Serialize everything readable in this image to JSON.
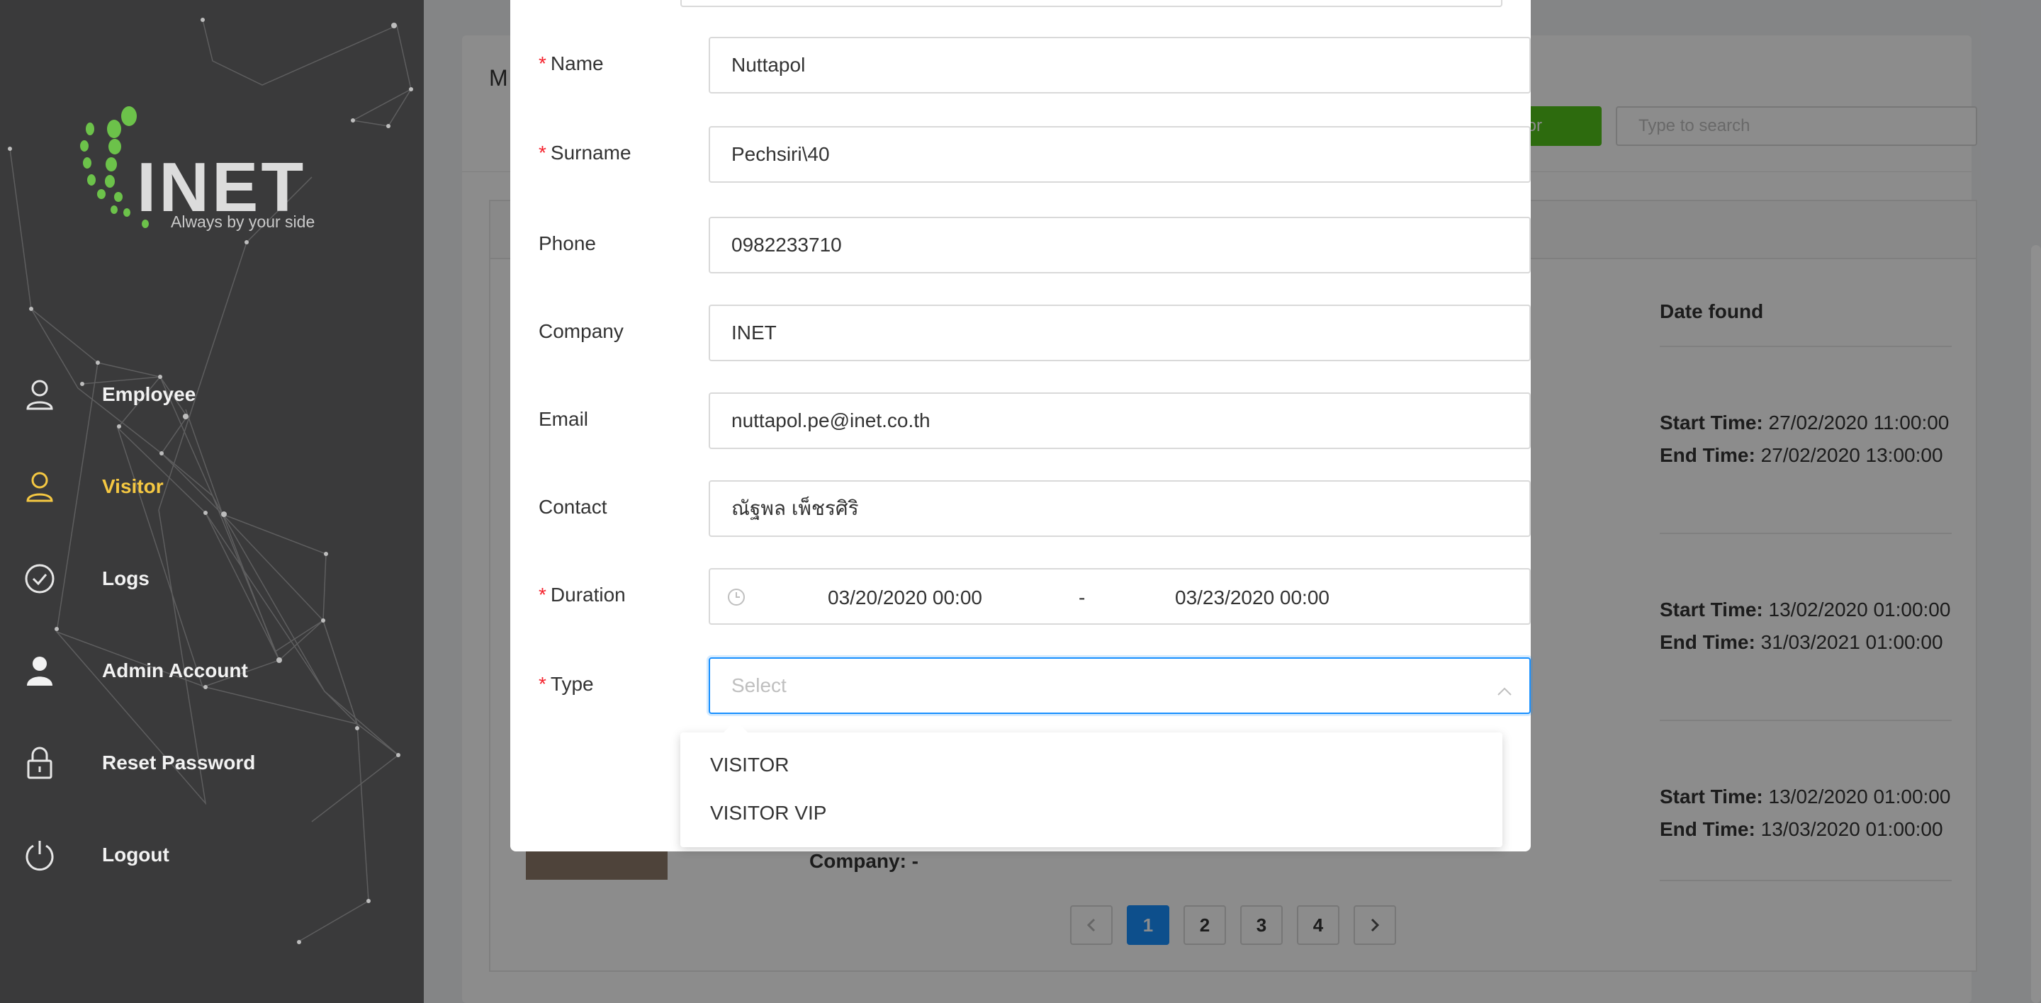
{
  "sidebar": {
    "logo_text": "INET",
    "logo_tagline": "Always by your side",
    "items": [
      {
        "label": "Employee",
        "icon": "user-outline-icon"
      },
      {
        "label": "Visitor",
        "icon": "user-outline-icon",
        "active": true
      },
      {
        "label": "Logs",
        "icon": "check-circle-icon"
      },
      {
        "label": "Admin Account",
        "icon": "user-filled-icon"
      },
      {
        "label": "Reset Password",
        "icon": "lock-icon"
      },
      {
        "label": "Logout",
        "icon": "power-icon"
      }
    ],
    "active_color": "#f5c842"
  },
  "background": {
    "card_title": "M",
    "add_button": "tor",
    "search_placeholder": "Type to search",
    "column_header": "Date found",
    "rows": [
      {
        "start_label": "Start Time:",
        "start": "27/02/2020 11:00:00",
        "end_label": "End Time:",
        "end": "27/02/2020 13:00:00"
      },
      {
        "start_label": "Start Time:",
        "start": "13/02/2020 01:00:00",
        "end_label": "End Time:",
        "end": "31/03/2021 01:00:00"
      },
      {
        "start_label": "Start Time:",
        "start": "13/02/2020 01:00:00",
        "end_label": "End Time:",
        "end": "13/03/2020 01:00:00"
      }
    ],
    "company_text": "Company: -",
    "pagination": {
      "pages": [
        "1",
        "2",
        "3",
        "4"
      ],
      "current": "1",
      "prev_icon": "chevron-left-icon",
      "next_icon": "chevron-right-icon"
    }
  },
  "form": {
    "name": {
      "label": "Name",
      "value": "Nuttapol",
      "required": true
    },
    "surname": {
      "label": "Surname",
      "value": "Pechsiri\\40",
      "required": true
    },
    "phone": {
      "label": "Phone",
      "value": "0982233710"
    },
    "company": {
      "label": "Company",
      "value": "INET"
    },
    "email": {
      "label": "Email",
      "value": "nuttapol.pe@inet.co.th"
    },
    "contact": {
      "label": "Contact",
      "value": "ณัฐพล เพ็ชรศิริ"
    },
    "duration": {
      "label": "Duration",
      "required": true,
      "start": "03/20/2020 00:00",
      "separator": "-",
      "end": "03/23/2020 00:00"
    },
    "type": {
      "label": "Type",
      "required": true,
      "placeholder": "Select",
      "options": [
        "VISITOR",
        "VISITOR VIP"
      ]
    },
    "required_mark": "*"
  },
  "colors": {
    "primary": "#1890ff",
    "required": "#f5222d",
    "success": "#52c41a",
    "sidebar_bg": "#3a3a3b"
  }
}
